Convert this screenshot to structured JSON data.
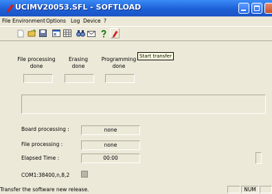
{
  "window": {
    "title": "UCIMV20053.SFL - SOFTLOAD"
  },
  "menu": [
    "File",
    "Environment",
    "Options",
    "Log",
    "Device",
    "?"
  ],
  "toolbar": {
    "icons": [
      "new-file-icon",
      "open-folder-icon",
      "save-icon",
      "properties-icon",
      "table-icon",
      "binoculars-icon",
      "mail-icon",
      "help-icon",
      "start-transfer-icon"
    ],
    "tooltip": "Start transfer"
  },
  "steps": [
    {
      "line1": "File processing",
      "line2": "done"
    },
    {
      "line1": "Erasing",
      "line2": "done"
    },
    {
      "line1": "Programming",
      "line2": "done"
    }
  ],
  "info": {
    "board_processing_label": "Board processing :",
    "board_processing_value": "none",
    "file_processing_label": "File processing  :",
    "file_processing_value": "none",
    "elapsed_time_label": "Elapsed Time     :",
    "elapsed_time_value": "00:00",
    "com_settings": "COM1:38400,n,8,2"
  },
  "status": {
    "text": "Transfer the software new release.",
    "num": "NUM"
  }
}
